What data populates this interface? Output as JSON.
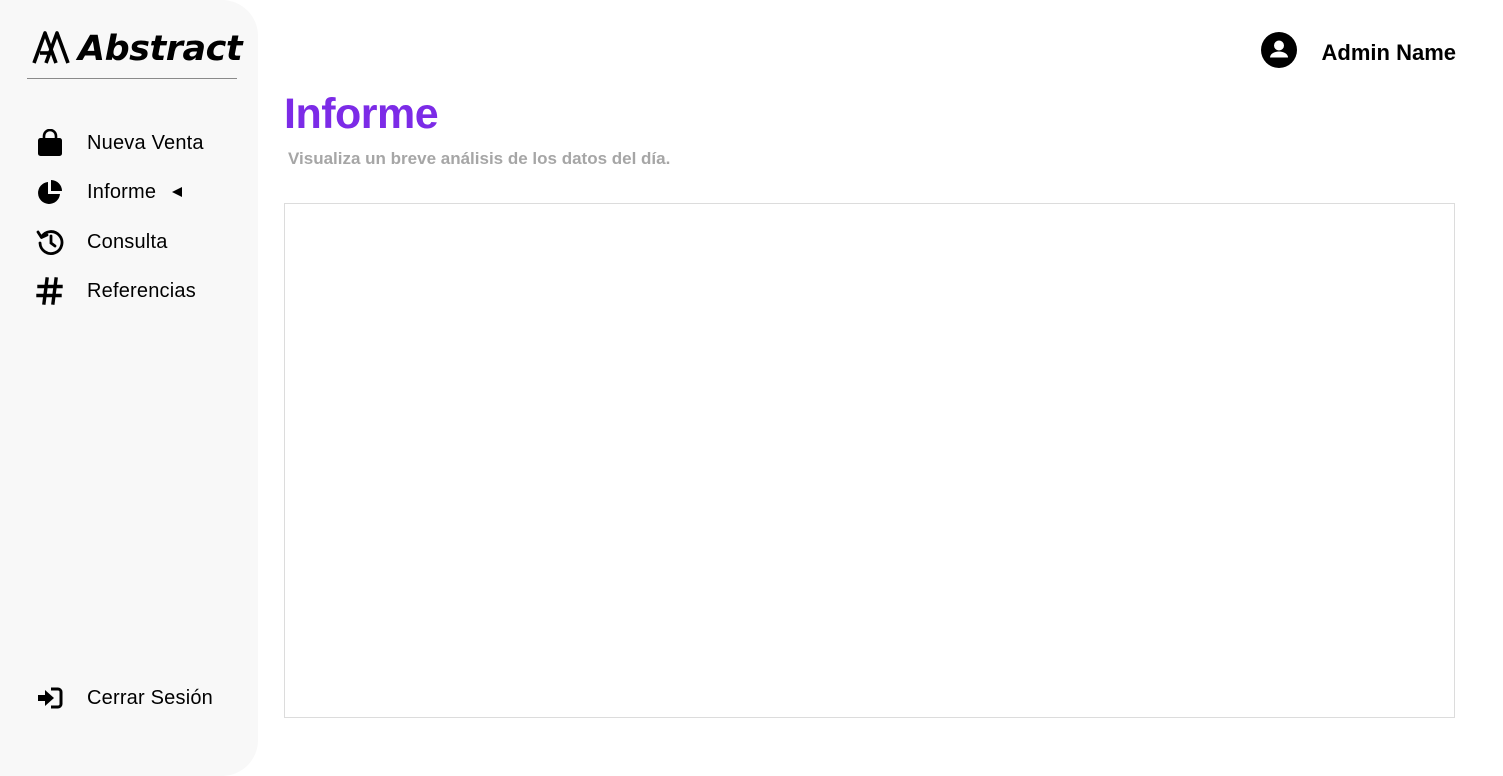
{
  "brand": {
    "name": "Abstract",
    "icon": "abstract-logo-icon"
  },
  "sidebar": {
    "items": [
      {
        "label": "Nueva Venta",
        "icon": "shopping-bag-icon",
        "active": false
      },
      {
        "label": "Informe",
        "icon": "pie-chart-icon",
        "active": true
      },
      {
        "label": "Consulta",
        "icon": "history-icon",
        "active": false
      },
      {
        "label": "Referencias",
        "icon": "hashtag-icon",
        "active": false
      }
    ],
    "logout": {
      "label": "Cerrar Sesión",
      "icon": "sign-in-icon"
    }
  },
  "header": {
    "user_name": "Admin Name",
    "user_icon": "user-circle-icon"
  },
  "main": {
    "title": "Informe",
    "subtitle": "Visualiza un breve análisis de los datos del día."
  },
  "colors": {
    "accent": "#7c2be7",
    "sidebar_bg": "#f8f8f8",
    "subtitle": "#a6a6a6",
    "panel_border": "#dcdcdc"
  }
}
